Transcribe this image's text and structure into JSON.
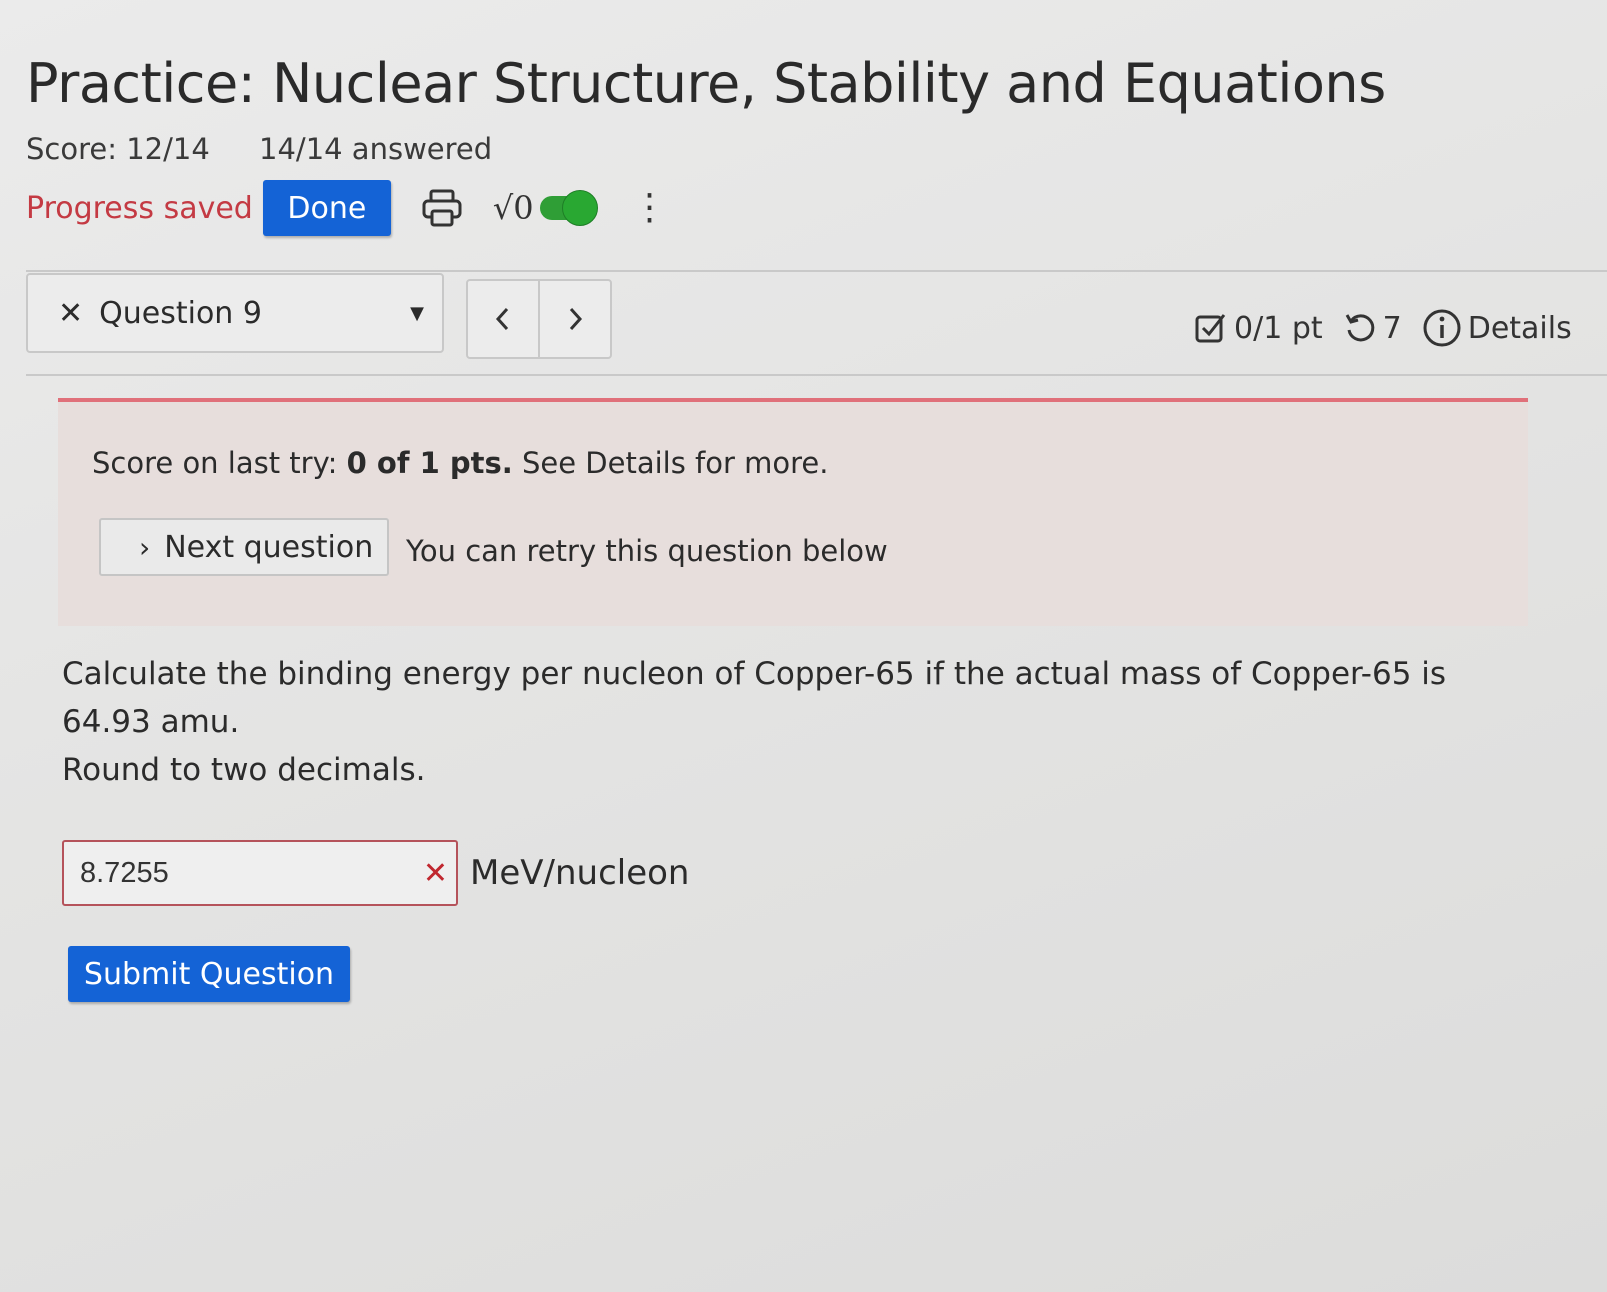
{
  "header": {
    "title": "Practice: Nuclear Structure, Stability and Equations",
    "score": "Score: 12/14",
    "answered": "14/14 answered"
  },
  "toolbar": {
    "progress_text": "Progress saved",
    "done_label": "Done",
    "print_icon": "printer-icon",
    "math_label": "√0",
    "math_toggle_on": true,
    "more_icon": "kebab-menu-icon",
    "accent_color": "#1463d6",
    "toggle_color": "#2f9e36"
  },
  "question_nav": {
    "status_icon": "x-icon",
    "selected_question": "Question 9",
    "prev_label": "<",
    "next_label": ">"
  },
  "meta": {
    "points": "0/1 pt",
    "retries": "7",
    "details_label": "Details"
  },
  "feedback": {
    "prefix": "Score on last try: ",
    "score": "0 of 1 pts.",
    "suffix": " See Details for more.",
    "next_button": "Next question",
    "retry_text": "You can retry this question below",
    "status_color": "#e0707a"
  },
  "question": {
    "text": "Calculate the binding energy per nucleon of Copper-65 if the actual mass of Copper-65 is 64.93 amu.",
    "instruction": "Round to two decimals.",
    "answer_value": "8.7255",
    "answer_status": "incorrect",
    "units": "MeV/nucleon",
    "submit_label": "Submit Question"
  }
}
